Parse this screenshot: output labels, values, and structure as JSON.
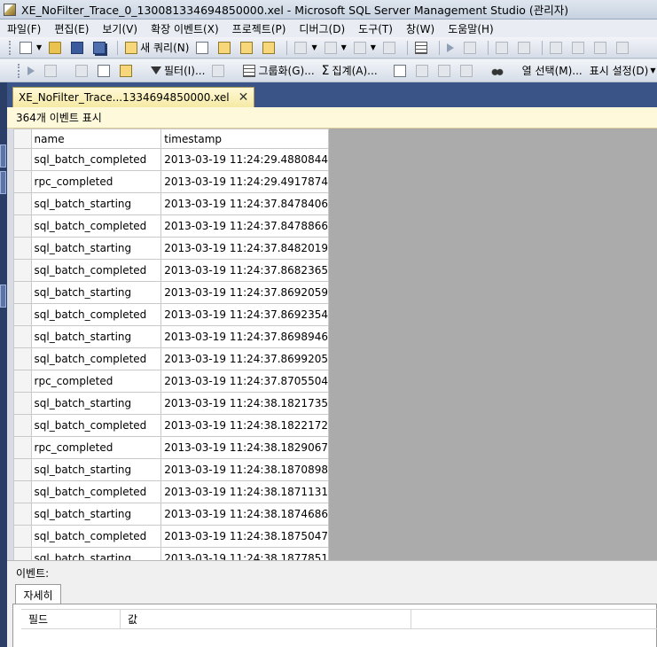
{
  "window": {
    "title": "XE_NoFilter_Trace_0_130081334694850000.xel - Microsoft SQL Server Management Studio (관리자)"
  },
  "menu": [
    "파일(F)",
    "편집(E)",
    "보기(V)",
    "확장 이벤트(X)",
    "프로젝트(P)",
    "디버그(D)",
    "도구(T)",
    "창(W)",
    "도움말(H)"
  ],
  "toolbar1": {
    "new_query": "새 쿼리(N)"
  },
  "toolbar2": {
    "filter": "필터(I)...",
    "grouping": "그룹화(G)...",
    "aggregation": "집계(A)...",
    "choose_columns": "열 선택(M)...",
    "display_settings": "표시 설정(D)"
  },
  "document_tab": {
    "label": "XE_NoFilter_Trace...1334694850000.xel",
    "close": "✕"
  },
  "events_info": "364개 이벤트 표시",
  "grid": {
    "columns": [
      "name",
      "timestamp"
    ],
    "rows": [
      [
        "sql_batch_completed",
        "2013-03-19 11:24:29.4880844"
      ],
      [
        "rpc_completed",
        "2013-03-19 11:24:29.4917874"
      ],
      [
        "sql_batch_starting",
        "2013-03-19 11:24:37.8478406"
      ],
      [
        "sql_batch_completed",
        "2013-03-19 11:24:37.8478866"
      ],
      [
        "sql_batch_starting",
        "2013-03-19 11:24:37.8482019"
      ],
      [
        "sql_batch_completed",
        "2013-03-19 11:24:37.8682365"
      ],
      [
        "sql_batch_starting",
        "2013-03-19 11:24:37.8692059"
      ],
      [
        "sql_batch_completed",
        "2013-03-19 11:24:37.8692354"
      ],
      [
        "sql_batch_starting",
        "2013-03-19 11:24:37.8698946"
      ],
      [
        "sql_batch_completed",
        "2013-03-19 11:24:37.8699205"
      ],
      [
        "rpc_completed",
        "2013-03-19 11:24:37.8705504"
      ],
      [
        "sql_batch_starting",
        "2013-03-19 11:24:38.1821735"
      ],
      [
        "sql_batch_completed",
        "2013-03-19 11:24:38.1822172"
      ],
      [
        "rpc_completed",
        "2013-03-19 11:24:38.1829067"
      ],
      [
        "sql_batch_starting",
        "2013-03-19 11:24:38.1870898"
      ],
      [
        "sql_batch_completed",
        "2013-03-19 11:24:38.1871131"
      ],
      [
        "sql_batch_starting",
        "2013-03-19 11:24:38.1874686"
      ],
      [
        "sql_batch_completed",
        "2013-03-19 11:24:38.1875047"
      ],
      [
        "sql_batch_starting",
        "2013-03-19 11:24:38.1877851"
      ]
    ]
  },
  "details": {
    "section_label": "이벤트:",
    "tab": "자세히",
    "columns": [
      "필드",
      "값"
    ]
  },
  "icons": [
    "new-document-icon",
    "open-folder-icon",
    "save-icon",
    "save-all-icon",
    "new-query-icon",
    "undo-icon",
    "redo-icon",
    "execute-icon",
    "filter-icon",
    "grouping-icon",
    "sigma-icon",
    "find-icon",
    "close-icon"
  ]
}
